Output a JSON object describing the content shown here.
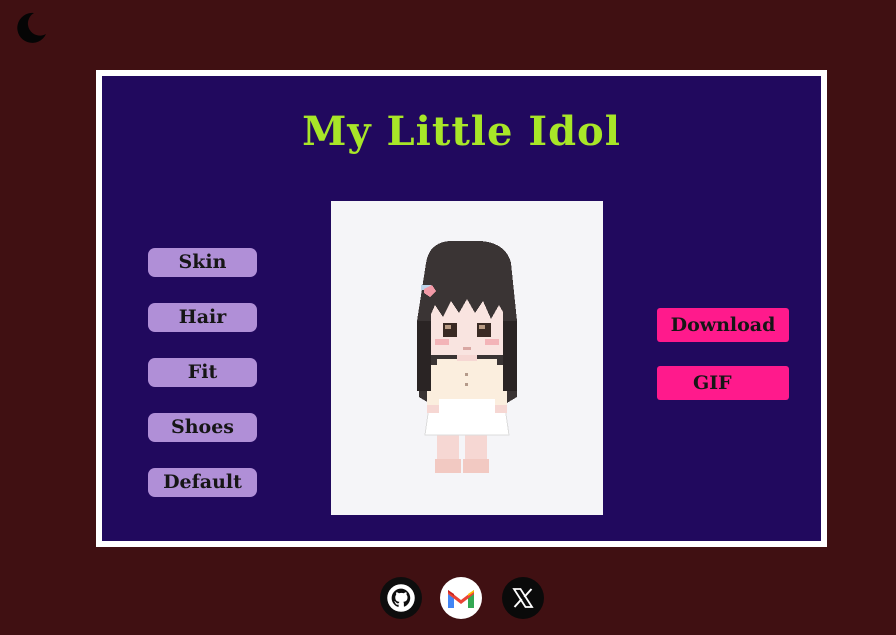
{
  "theme_toggle": {
    "icon": "moon-icon"
  },
  "app": {
    "title": "My Little Idol"
  },
  "sidebar": {
    "items": [
      {
        "label": "Skin"
      },
      {
        "label": "Hair"
      },
      {
        "label": "Fit"
      },
      {
        "label": "Shoes"
      },
      {
        "label": "Default"
      }
    ]
  },
  "actions": {
    "download_label": "Download",
    "gif_label": "GIF"
  },
  "footer": {
    "links": [
      {
        "icon": "github-icon"
      },
      {
        "icon": "gmail-icon"
      },
      {
        "icon": "x-icon"
      }
    ]
  },
  "colors": {
    "background": "#401012",
    "panel": "#21095e",
    "title": "#a8e628",
    "side_button": "#b08fd7",
    "action_button": "#ff1a8c"
  }
}
